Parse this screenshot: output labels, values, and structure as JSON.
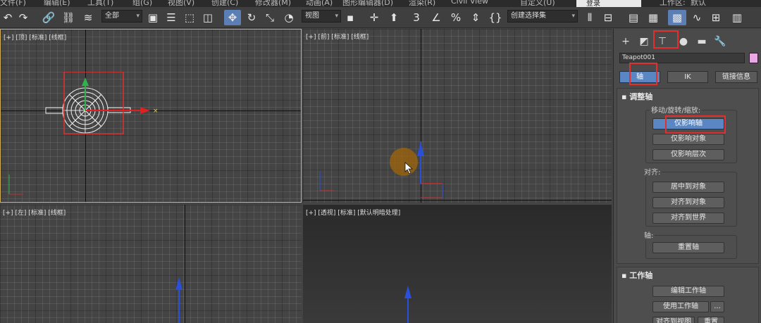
{
  "menubar": {
    "items": [
      "文件(F)",
      "编辑(E)",
      "工具(T)",
      "组(G)",
      "视图(V)",
      "创建(C)",
      "修改器(M)",
      "动画(A)",
      "图形编辑器(D)",
      "渲染(R)",
      "Civil View",
      "自定义(U)"
    ],
    "search_value": "登录",
    "workspace_label": "工作区:",
    "workspace_value": "默认"
  },
  "toolbar": {
    "filter_dropdown": "全部",
    "ref_coord_dropdown": "视图",
    "selection_set_dropdown": "创建选择集"
  },
  "viewports": {
    "top": "[+] [顶] [标准] [线框]",
    "front": "[+] [前] [标准] [线框]",
    "left": "[+] [左] [标准] [线框]",
    "perspective": "[+] [透视] [标准] [默认明暗处理]"
  },
  "panel": {
    "object_name": "Teapot001",
    "tabs": [
      "轴",
      "IK",
      "链接信息"
    ],
    "adjust_pivot": {
      "title": "调整轴",
      "move_group_label": "移动/旋转/缩放:",
      "affect_pivot_only": "仅影响轴",
      "affect_object_only": "仅影响对象",
      "affect_hierarchy_only": "仅影响层次",
      "align_group_label": "对齐:",
      "center_to_object": "居中到对象",
      "align_to_object": "对齐到对象",
      "align_to_world": "对齐到世界",
      "pivot_group_label": "轴:",
      "reset_pivot": "重置轴"
    },
    "working_pivot": {
      "title": "工作轴",
      "edit_working_pivot": "编辑工作轴",
      "use_working_pivot": "使用工作轴",
      "more_button": "...",
      "align_to_view": "对齐到视图",
      "reset": "重置"
    }
  },
  "colors": {
    "accent": "#5b86c4",
    "highlight_box": "#e03030",
    "active_viewport_border": "#d6b35a",
    "swatch": "#e8a8e6"
  }
}
